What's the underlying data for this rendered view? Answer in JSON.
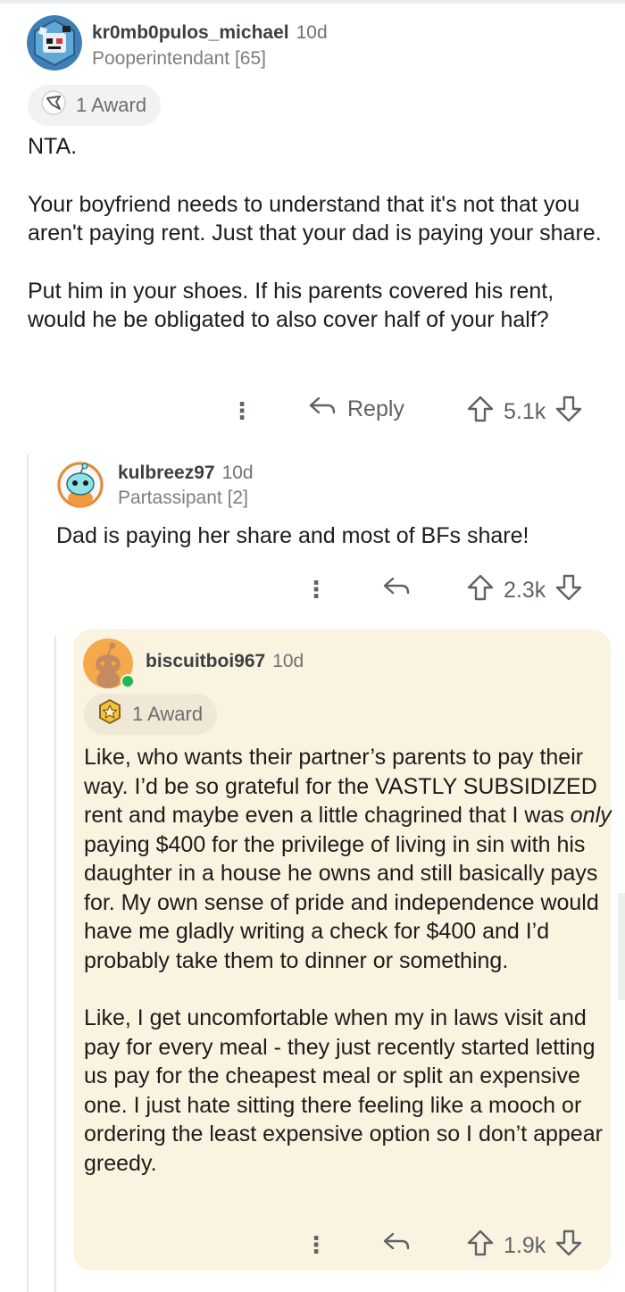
{
  "comments": [
    {
      "username": "kr0mb0pulos_michael",
      "age": "10d",
      "flair": "Pooperintendant [65]",
      "award_label": "1 Award",
      "paragraphs": [
        "NTA.",
        "Your boyfriend needs to understand that it's not that you aren't paying rent. Just that your dad is paying your share.",
        "Put him in your shoes. If his parents covered his rent, would he be obligated to also cover half of your half?"
      ],
      "reply_label": "Reply",
      "votes": "5.1k",
      "avatar_icon": "robot-avatar-icon"
    },
    {
      "username": "kulbreez97",
      "age": "10d",
      "flair": "Partassipant [2]",
      "paragraphs": [
        "Dad is paying her share and most of BFs share!"
      ],
      "votes": "2.3k",
      "avatar_icon": "snoo-avatar-icon"
    },
    {
      "username": "biscuitboi967",
      "age": "10d",
      "award_label": "1 Award",
      "paragraph1": {
        "before": "Like, who wants their partner’s parents to pay their way. I’d be so grateful for the VASTLY SUBSIDIZED rent and maybe even a little chagrined that I was ",
        "emph": "only",
        "after": " paying $400 for the privilege of living in sin with his daughter in a house he owns and still basically pays for. My own sense of pride and independence would have me gladly writing a check for $400 and I’d probably take them to dinner or something."
      },
      "paragraph2": "Like, I get uncomfortable when my in laws visit and pay for every meal - they just recently started letting us pay for the cheapest meal or split an expensive one. I just hate sitting there feeling like a mooch or ordering the least expensive option so I don’t appear greedy.",
      "votes": "1.9k",
      "avatar_icon": "default-snoo-avatar-icon"
    }
  ],
  "colors": {
    "highlight_bg": "#faf3e0",
    "online": "#1fb853",
    "text": "#1c1c1c",
    "muted": "#5f6368"
  }
}
